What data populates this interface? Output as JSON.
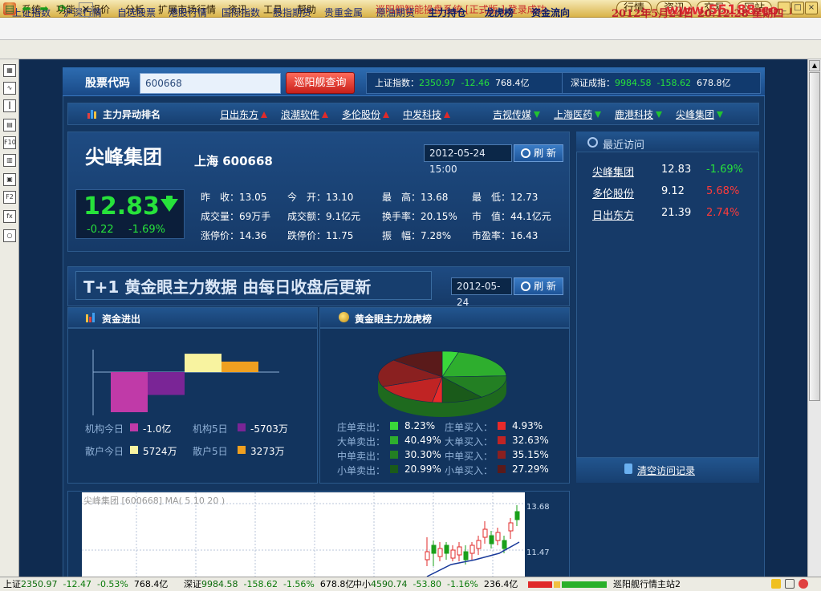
{
  "menu": {
    "items": [
      "系统",
      "功能",
      "报价",
      "分析",
      "扩展市场行情",
      "资讯",
      "工具",
      "帮助"
    ],
    "app_title": "巡阳舰智能操盘系统 [正式版 ] 登录成功",
    "top_buttons": [
      "行情",
      "资讯",
      "交易",
      "网站"
    ],
    "watermark": "www.55188.com"
  },
  "nav": {
    "items": [
      "上证指数",
      "沪深行情",
      "自选股票",
      "港股行情",
      "国际指数",
      "股指期货",
      "贵重金属",
      "原油期货",
      "主力持仓",
      "龙虎榜",
      "资金流向"
    ],
    "datetime": "2012年5月24日  20:12:28  星期四"
  },
  "search": {
    "label": "股票代码",
    "value": "600668",
    "button": "巡阳舰查询"
  },
  "indices": {
    "sh": {
      "label": "上证指数：",
      "value": "2350.97",
      "change": "-12.46",
      "volume": "768.4亿"
    },
    "sz": {
      "label": "深证成指：",
      "value": "9984.58",
      "change": "-158.62",
      "volume": "678.8亿"
    }
  },
  "movers": {
    "title": "主力异动排名",
    "items": [
      {
        "name": "日出东方",
        "dir": "up"
      },
      {
        "name": "浪潮软件",
        "dir": "up"
      },
      {
        "name": "多伦股份",
        "dir": "up"
      },
      {
        "name": "中发科技",
        "dir": "up"
      },
      {
        "name": "吉视传媒",
        "dir": "down"
      },
      {
        "name": "上海医药",
        "dir": "down"
      },
      {
        "name": "鹿港科技",
        "dir": "down"
      },
      {
        "name": "尖峰集团",
        "dir": "down"
      }
    ]
  },
  "stock": {
    "name": "尖峰集团",
    "exchange": "上海 600668",
    "datetime": "2012-05-24 15:00",
    "refresh": "刷 新",
    "price": "12.83",
    "change": "-0.22",
    "change_pct": "-1.69%",
    "stats": [
      [
        {
          "label": "昨　收：",
          "value": "13.05"
        },
        {
          "label": "今　开：",
          "value": "13.10"
        },
        {
          "label": "最　高：",
          "value": "13.68"
        },
        {
          "label": "最　低：",
          "value": "12.73"
        }
      ],
      [
        {
          "label": "成交量：",
          "value": "69万手"
        },
        {
          "label": "成交额：",
          "value": "9.1亿元"
        },
        {
          "label": "换手率：",
          "value": "20.15%"
        },
        {
          "label": "市　值：",
          "value": "44.1亿元"
        }
      ],
      [
        {
          "label": "涨停价：",
          "value": "14.36"
        },
        {
          "label": "跌停价：",
          "value": "11.75"
        },
        {
          "label": "振　幅：",
          "value": "7.28%"
        },
        {
          "label": "市盈率：",
          "value": "16.43"
        }
      ]
    ]
  },
  "recent": {
    "title": "最近访问",
    "items": [
      {
        "name": "尖峰集团",
        "price": "12.83",
        "pct": "-1.69%",
        "dir": "down"
      },
      {
        "name": "多伦股份",
        "price": "9.12",
        "pct": "5.68%",
        "dir": "up"
      },
      {
        "name": "日出东方",
        "price": "21.39",
        "pct": "2.74%",
        "dir": "up"
      }
    ],
    "clear": "清空访问记录"
  },
  "t1": {
    "title": "T+1 黄金眼主力数据 由每日收盘后更新",
    "date": "2012-05-24",
    "refresh": "刷 新"
  },
  "funds": {
    "title": "资金进出",
    "legend": [
      {
        "label": "机构今日",
        "value": "-1.0亿",
        "color": "#c03aa8"
      },
      {
        "label": "机构5日",
        "value": "-5703万",
        "color": "#7a2596"
      },
      {
        "label": "散户今日",
        "value": "5724万",
        "color": "#f8f3a0"
      },
      {
        "label": "散户5日",
        "value": "3273万",
        "color": "#f0a020"
      }
    ]
  },
  "dragon": {
    "title": "黄金眼主力龙虎榜",
    "sell": [
      {
        "label": "庄单卖出：",
        "value": "8.23%",
        "color": "#3ad83a"
      },
      {
        "label": "大单卖出：",
        "value": "40.49%",
        "color": "#2eae2e"
      },
      {
        "label": "中单卖出：",
        "value": "30.30%",
        "color": "#237f23"
      },
      {
        "label": "小单卖出：",
        "value": "20.99%",
        "color": "#1a5a1a"
      }
    ],
    "buy": [
      {
        "label": "庄单买入：",
        "value": "4.93%",
        "color": "#e82a2a"
      },
      {
        "label": "大单买入：",
        "value": "32.63%",
        "color": "#c02424"
      },
      {
        "label": "中单买入：",
        "value": "35.15%",
        "color": "#8a2020"
      },
      {
        "label": "小单买入：",
        "value": "27.29%",
        "color": "#5a1a1a"
      }
    ]
  },
  "chart_data": [
    {
      "type": "bar",
      "title": "资金进出",
      "categories": [
        "机构今日",
        "机构5日",
        "散户今日",
        "散户5日"
      ],
      "values": [
        -10000,
        -5703,
        5724,
        3273
      ],
      "unit": "万"
    },
    {
      "type": "pie",
      "title": "黄金眼主力龙虎榜",
      "categories": [
        "庄单卖出",
        "大单卖出",
        "中单卖出",
        "小单卖出",
        "庄单买入",
        "大单买入",
        "中单买入",
        "小单买入"
      ],
      "values": [
        8.23,
        40.49,
        30.3,
        20.99,
        4.93,
        32.63,
        35.15,
        27.29
      ]
    }
  ],
  "kline": {
    "title": "尖峰集团 [600668] MA( 5  10  20 )",
    "high": "13.68",
    "low": "11.47"
  },
  "status": {
    "sh": {
      "label": "上证",
      "value": "2350.97",
      "change": "-12.47",
      "pct": "-0.53%",
      "vol": "768.4亿"
    },
    "sz": {
      "label": "深证",
      "value": "9984.58",
      "change": "-158.62",
      "pct": "-1.56%",
      "vol": "678.8亿"
    },
    "zx": {
      "label": "中小",
      "value": "4590.74",
      "change": "-53.80",
      "pct": "-1.16%",
      "vol": "236.4亿"
    },
    "server": "巡阳舰行情主站2"
  }
}
